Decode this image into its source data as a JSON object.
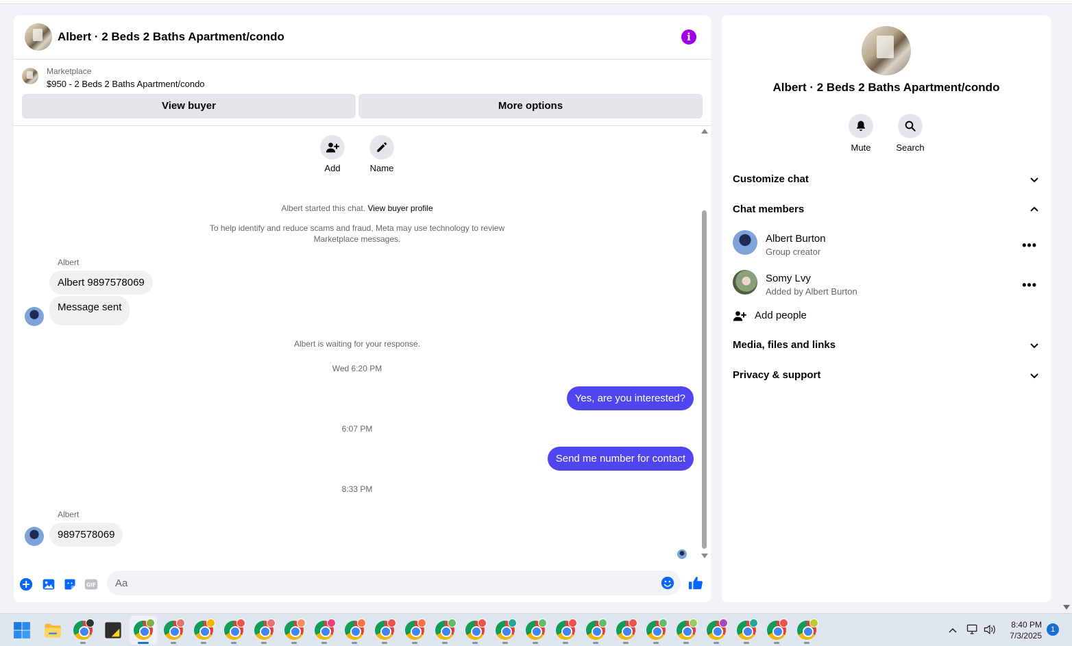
{
  "chat": {
    "title": "Albert · 2 Beds 2 Baths Apartment/condo",
    "marketplace_label": "Marketplace",
    "listing": "$950 - 2 Beds 2 Baths Apartment/condo",
    "view_buyer": "View buyer",
    "more_options": "More options",
    "actions": {
      "add": "Add",
      "name": "Name"
    },
    "started_text": "Albert started this chat.",
    "view_profile": "View buyer profile",
    "disclaimer_line1": "To help identify and reduce scams and fraud, Meta may use technology to review",
    "disclaimer_line2": "Marketplace messages.",
    "sender1": "Albert",
    "msg1": "Albert 9897578069",
    "msg2": "Message sent",
    "waiting": "Albert is waiting for your response.",
    "ts1": "Wed 6:20 PM",
    "out1": "Yes, are you interested?",
    "ts2": "6:07 PM",
    "out2": "Send me number for contact",
    "ts3": "8:33 PM",
    "sender2": "Albert",
    "msg3": "9897578069",
    "input_placeholder": "Aa",
    "accent": "#0866ff",
    "outgoing_bubble": "#4f46f0"
  },
  "info": {
    "title": "Albert · 2 Beds 2 Baths Apartment/condo",
    "mute": "Mute",
    "search": "Search",
    "customize": "Customize chat",
    "members_header": "Chat members",
    "members": [
      {
        "name": "Albert Burton",
        "sub": "Group creator"
      },
      {
        "name": "Somy Lvy",
        "sub": "Added by Albert Burton"
      }
    ],
    "add_people": "Add people",
    "media": "Media, files and links",
    "privacy": "Privacy & support"
  },
  "taskbar": {
    "time": "8:40 PM",
    "date": "7/3/2025",
    "notifications": "1"
  }
}
